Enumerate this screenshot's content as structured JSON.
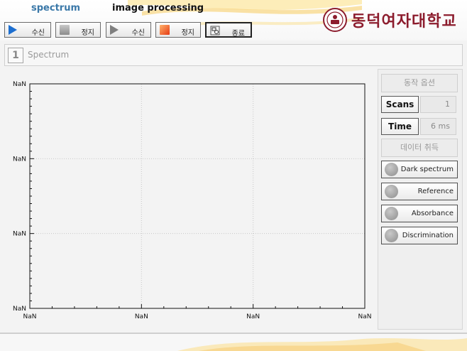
{
  "header": {
    "tabs": [
      {
        "label": "spectrum",
        "color": "#3a78a8"
      },
      {
        "label": "image processing",
        "color": "#111111"
      }
    ],
    "toolbar": [
      {
        "icon": "play-icon",
        "label": "수신"
      },
      {
        "icon": "stop-icon",
        "label": "정지"
      },
      {
        "icon": "play-icon",
        "label": "수신"
      },
      {
        "icon": "stop-icon",
        "label": "정지"
      },
      {
        "icon": "exit-icon",
        "label": "종료"
      }
    ],
    "logo_text": "동덕여자대학교",
    "logo_color": "#8c1c2d"
  },
  "section": {
    "number": "1",
    "title": "Spectrum"
  },
  "chart_data": {
    "type": "line",
    "series": [],
    "x_tick_labels": [
      "NaN",
      "NaN",
      "NaN",
      "NaN"
    ],
    "y_tick_labels": [
      "NaN",
      "NaN",
      "NaN",
      "NaN"
    ],
    "grid": true,
    "grid_style": "dotted"
  },
  "panel": {
    "options_label": "동작 옵션",
    "scans_label": "Scans",
    "scans_value": "1",
    "time_label": "Time",
    "time_value": "6 ms",
    "data_label": "데이터 취득",
    "actions": [
      {
        "label": "Dark spectrum"
      },
      {
        "label": "Reference"
      },
      {
        "label": "Absorbance"
      },
      {
        "label": "Discrimination"
      }
    ]
  }
}
